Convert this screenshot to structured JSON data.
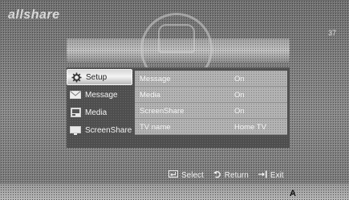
{
  "app": {
    "logo": "allshare",
    "channel": "37"
  },
  "sidebar": {
    "items": [
      {
        "label": "Setup",
        "icon": "gear-icon",
        "active": true
      },
      {
        "label": "Message",
        "icon": "envelope-icon",
        "active": false
      },
      {
        "label": "Media",
        "icon": "media-icon",
        "active": false
      },
      {
        "label": "ScreenShare",
        "icon": "screen-icon",
        "active": false
      }
    ]
  },
  "settings": {
    "rows": [
      {
        "label": "Message",
        "value": "On"
      },
      {
        "label": "Media",
        "value": "On"
      },
      {
        "label": "ScreenShare",
        "value": "On"
      },
      {
        "label": "TV name",
        "value": "Home TV"
      }
    ]
  },
  "footer": {
    "select": "Select",
    "return": "Return",
    "exit": "Exit"
  },
  "annotation": {
    "marker": "A"
  }
}
